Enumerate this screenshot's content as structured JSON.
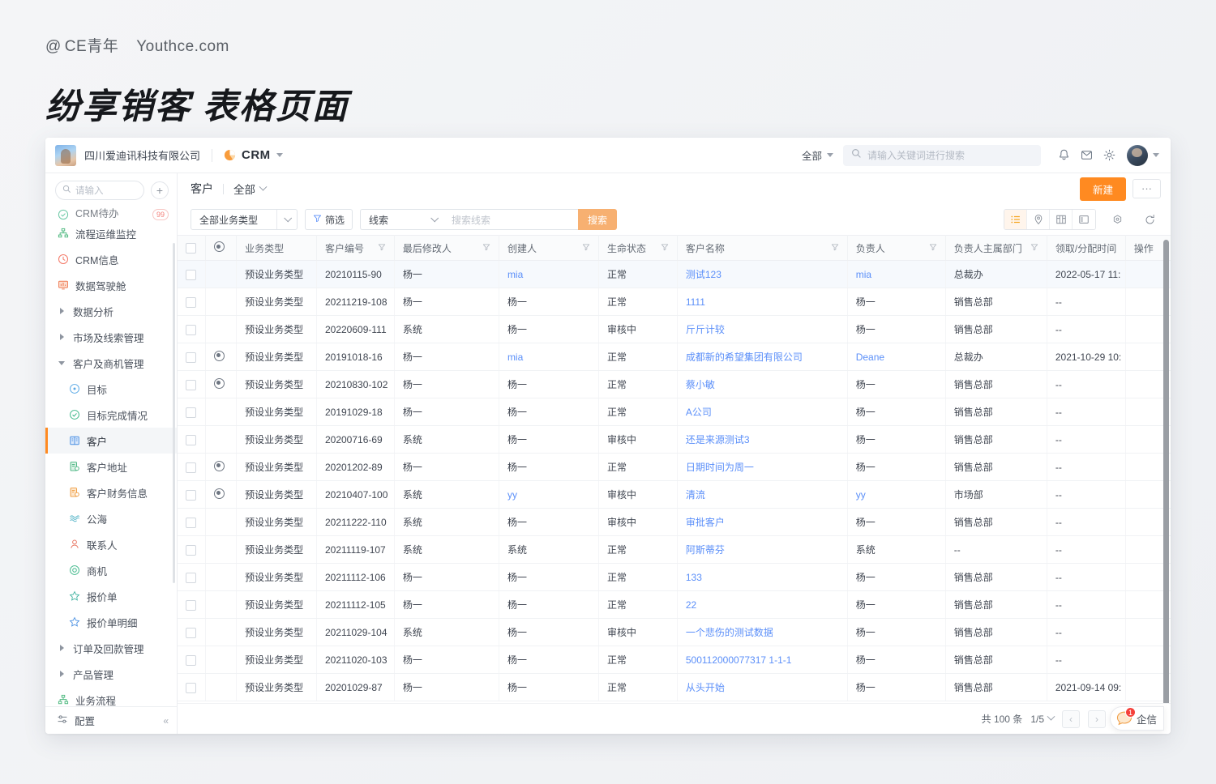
{
  "poster": {
    "handle_at": "@",
    "handle_name": "CE青年",
    "site": "Youthce.com",
    "title": "纷享销客 表格页面"
  },
  "topbar": {
    "company": "四川爱迪讯科技有限公司",
    "app_name": "CRM",
    "scope_label": "全部",
    "search_placeholder": "请输入关键词进行搜索",
    "icons": [
      "bell-icon",
      "inbox-icon",
      "gear-icon",
      "avatar"
    ]
  },
  "sidebar": {
    "search_placeholder": "请输入",
    "add_label": "+",
    "items": [
      {
        "label": "CRM待办",
        "icon": "clock-check-icon",
        "badge": "99",
        "type": "cut"
      },
      {
        "label": "流程运维监控",
        "icon": "sitemap-icon",
        "type": "item"
      },
      {
        "label": "CRM信息",
        "icon": "clock-icon",
        "type": "item"
      },
      {
        "label": "数据驾驶舱",
        "icon": "dashboard-icon",
        "type": "item"
      },
      {
        "label": "数据分析",
        "icon": "triangle-right-icon",
        "type": "group"
      },
      {
        "label": "市场及线索管理",
        "icon": "triangle-right-icon",
        "type": "group"
      },
      {
        "label": "客户及商机管理",
        "icon": "triangle-down-icon",
        "type": "group-open"
      },
      {
        "label": "目标",
        "icon": "target-icon",
        "type": "sub"
      },
      {
        "label": "目标完成情况",
        "icon": "check-circle-icon",
        "type": "sub"
      },
      {
        "label": "客户",
        "icon": "customer-icon",
        "type": "sub",
        "active": true
      },
      {
        "label": "客户地址",
        "icon": "address-icon",
        "type": "sub"
      },
      {
        "label": "客户财务信息",
        "icon": "finance-icon",
        "type": "sub"
      },
      {
        "label": "公海",
        "icon": "waves-icon",
        "type": "sub"
      },
      {
        "label": "联系人",
        "icon": "person-icon",
        "type": "sub"
      },
      {
        "label": "商机",
        "icon": "opportunity-icon",
        "type": "sub"
      },
      {
        "label": "报价单",
        "icon": "quote-icon",
        "type": "sub"
      },
      {
        "label": "报价单明细",
        "icon": "quote-detail-icon",
        "type": "sub"
      },
      {
        "label": "订单及回款管理",
        "icon": "triangle-right-icon",
        "type": "group"
      },
      {
        "label": "产品管理",
        "icon": "triangle-right-icon",
        "type": "group"
      },
      {
        "label": "业务流程",
        "icon": "sitemap-icon",
        "type": "item"
      }
    ],
    "footer": {
      "label": "配置",
      "icon": "settings-sliders-icon",
      "collapse_icon": "«"
    }
  },
  "page_head": {
    "breadcrumb": "客户",
    "view_name": "全部",
    "new_button": "新建",
    "more_button": "···"
  },
  "toolbar": {
    "biz_type": "全部业务类型",
    "filter_label": "筛选",
    "search_scope": "线索",
    "search_placeholder": "搜索线索",
    "search_button": "搜索",
    "view_modes": [
      "list-view-icon",
      "map-view-icon",
      "kanban-view-icon",
      "split-view-icon"
    ],
    "active_view": "list-view-icon",
    "settings_icon": "column-settings-icon",
    "refresh_icon": "refresh-icon"
  },
  "table": {
    "columns": [
      {
        "key": "checkbox",
        "label": "",
        "filter": false
      },
      {
        "key": "radio",
        "label": "",
        "filter": false
      },
      {
        "key": "biz_type",
        "label": "业务类型",
        "filter": false
      },
      {
        "key": "cust_no",
        "label": "客户编号",
        "filter": true
      },
      {
        "key": "last_modifier",
        "label": "最后修改人",
        "filter": true
      },
      {
        "key": "creator",
        "label": "创建人",
        "filter": true
      },
      {
        "key": "life_status",
        "label": "生命状态",
        "filter": true
      },
      {
        "key": "cust_name",
        "label": "客户名称",
        "filter": true
      },
      {
        "key": "owner",
        "label": "负责人",
        "filter": true
      },
      {
        "key": "owner_dept",
        "label": "负责人主属部门",
        "filter": true
      },
      {
        "key": "assign_time",
        "label": "领取/分配时间",
        "filter": false
      },
      {
        "key": "action",
        "label": "操作",
        "filter": false
      }
    ],
    "rows": [
      {
        "radio": false,
        "biz_type": "预设业务类型",
        "cust_no": "20210115-90",
        "last_modifier": "杨一",
        "creator": "mia",
        "creator_link": true,
        "life_status": "正常",
        "cust_name": "测试123",
        "owner": "mia",
        "owner_link": true,
        "owner_dept": "总裁办",
        "assign_time": "2022-05-17 11:",
        "selected": true
      },
      {
        "radio": false,
        "biz_type": "预设业务类型",
        "cust_no": "20211219-108",
        "last_modifier": "杨一",
        "creator": "杨一",
        "creator_link": false,
        "life_status": "正常",
        "cust_name": "1111",
        "owner": "杨一",
        "owner_link": false,
        "owner_dept": "销售总部",
        "assign_time": "--"
      },
      {
        "radio": false,
        "biz_type": "预设业务类型",
        "cust_no": "20220609-111",
        "last_modifier": "系统",
        "creator": "杨一",
        "creator_link": false,
        "life_status": "审核中",
        "cust_name": "斤斤计较",
        "owner": "杨一",
        "owner_link": false,
        "owner_dept": "销售总部",
        "assign_time": "--"
      },
      {
        "radio": true,
        "biz_type": "预设业务类型",
        "cust_no": "20191018-16",
        "last_modifier": "杨一",
        "creator": "mia",
        "creator_link": true,
        "life_status": "正常",
        "cust_name": "成都新的希望集团有限公司",
        "owner": "Deane",
        "owner_link": true,
        "owner_dept": "总裁办",
        "assign_time": "2021-10-29 10:"
      },
      {
        "radio": true,
        "biz_type": "预设业务类型",
        "cust_no": "20210830-102",
        "last_modifier": "杨一",
        "creator": "杨一",
        "creator_link": false,
        "life_status": "正常",
        "cust_name": "蔡小敏",
        "owner": "杨一",
        "owner_link": false,
        "owner_dept": "销售总部",
        "assign_time": "--"
      },
      {
        "radio": false,
        "biz_type": "预设业务类型",
        "cust_no": "20191029-18",
        "last_modifier": "杨一",
        "creator": "杨一",
        "creator_link": false,
        "life_status": "正常",
        "cust_name": "A公司",
        "owner": "杨一",
        "owner_link": false,
        "owner_dept": "销售总部",
        "assign_time": "--"
      },
      {
        "radio": false,
        "biz_type": "预设业务类型",
        "cust_no": "20200716-69",
        "last_modifier": "系统",
        "creator": "杨一",
        "creator_link": false,
        "life_status": "审核中",
        "cust_name": "还是来源测试3",
        "owner": "杨一",
        "owner_link": false,
        "owner_dept": "销售总部",
        "assign_time": "--"
      },
      {
        "radio": true,
        "biz_type": "预设业务类型",
        "cust_no": "20201202-89",
        "last_modifier": "杨一",
        "creator": "杨一",
        "creator_link": false,
        "life_status": "正常",
        "cust_name": "日期时间为周一",
        "owner": "杨一",
        "owner_link": false,
        "owner_dept": "销售总部",
        "assign_time": "--"
      },
      {
        "radio": true,
        "biz_type": "预设业务类型",
        "cust_no": "20210407-100",
        "last_modifier": "系统",
        "creator": "yy",
        "creator_link": true,
        "life_status": "审核中",
        "cust_name": "清流",
        "owner": "yy",
        "owner_link": true,
        "owner_dept": "市场部",
        "assign_time": "--"
      },
      {
        "radio": false,
        "biz_type": "预设业务类型",
        "cust_no": "20211222-110",
        "last_modifier": "系统",
        "creator": "杨一",
        "creator_link": false,
        "life_status": "审核中",
        "cust_name": "审批客户",
        "owner": "杨一",
        "owner_link": false,
        "owner_dept": "销售总部",
        "assign_time": "--"
      },
      {
        "radio": false,
        "biz_type": "预设业务类型",
        "cust_no": "20211119-107",
        "last_modifier": "系统",
        "creator": "系统",
        "creator_link": false,
        "life_status": "正常",
        "cust_name": "阿斯蒂芬",
        "owner": "系统",
        "owner_link": false,
        "owner_dept": "--",
        "assign_time": "--"
      },
      {
        "radio": false,
        "biz_type": "预设业务类型",
        "cust_no": "20211112-106",
        "last_modifier": "杨一",
        "creator": "杨一",
        "creator_link": false,
        "life_status": "正常",
        "cust_name": "133",
        "owner": "杨一",
        "owner_link": false,
        "owner_dept": "销售总部",
        "assign_time": "--"
      },
      {
        "radio": false,
        "biz_type": "预设业务类型",
        "cust_no": "20211112-105",
        "last_modifier": "杨一",
        "creator": "杨一",
        "creator_link": false,
        "life_status": "正常",
        "cust_name": "22",
        "owner": "杨一",
        "owner_link": false,
        "owner_dept": "销售总部",
        "assign_time": "--"
      },
      {
        "radio": false,
        "biz_type": "预设业务类型",
        "cust_no": "20211029-104",
        "last_modifier": "系统",
        "creator": "杨一",
        "creator_link": false,
        "life_status": "审核中",
        "cust_name": "一个悲伤的测试数据",
        "owner": "杨一",
        "owner_link": false,
        "owner_dept": "销售总部",
        "assign_time": "--"
      },
      {
        "radio": false,
        "biz_type": "预设业务类型",
        "cust_no": "20211020-103",
        "last_modifier": "杨一",
        "creator": "杨一",
        "creator_link": false,
        "life_status": "正常",
        "cust_name": "500112000077317 1-1-1",
        "owner": "杨一",
        "owner_link": false,
        "owner_dept": "销售总部",
        "assign_time": "--"
      },
      {
        "radio": false,
        "biz_type": "预设业务类型",
        "cust_no": "20201029-87",
        "last_modifier": "杨一",
        "creator": "杨一",
        "creator_link": false,
        "life_status": "正常",
        "cust_name": "从头开始",
        "owner": "杨一",
        "owner_link": false,
        "owner_dept": "销售总部",
        "assign_time": "2021-09-14 09:"
      }
    ]
  },
  "footer": {
    "total": "共 100 条",
    "page_indicator": "1/5",
    "prev": "‹",
    "next": "›"
  },
  "chat_widget": {
    "label": "企信",
    "badge": "1"
  },
  "colors": {
    "accent": "#ff8a21",
    "link": "#5b8ff9",
    "search_btn": "#f7b071",
    "badge": "#f5403a"
  }
}
